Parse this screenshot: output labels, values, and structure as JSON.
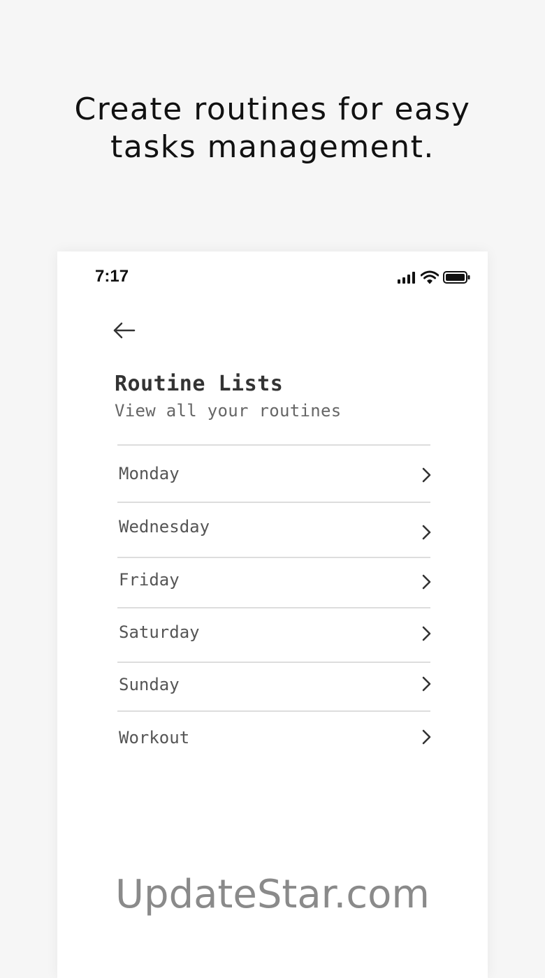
{
  "headline": {
    "line1": "Create routines for easy",
    "line2": "tasks management."
  },
  "status_bar": {
    "time": "7:17",
    "icons": [
      "cellular-signal-icon",
      "wifi-icon",
      "battery-icon"
    ]
  },
  "back_icon": "arrow-left-icon",
  "page": {
    "title": "Routine Lists",
    "subtitle": "View all your routines"
  },
  "routines": [
    {
      "label": "Monday"
    },
    {
      "label": "Wednesday"
    },
    {
      "label": "Friday"
    },
    {
      "label": "Saturday"
    },
    {
      "label": "Sunday"
    },
    {
      "label": "Workout"
    }
  ],
  "watermark": "UpdateStar.com",
  "colors": {
    "background": "#f6f6f6",
    "card": "#ffffff",
    "title": "#333333",
    "subtitle": "#666666",
    "divider": "#dddddd"
  }
}
